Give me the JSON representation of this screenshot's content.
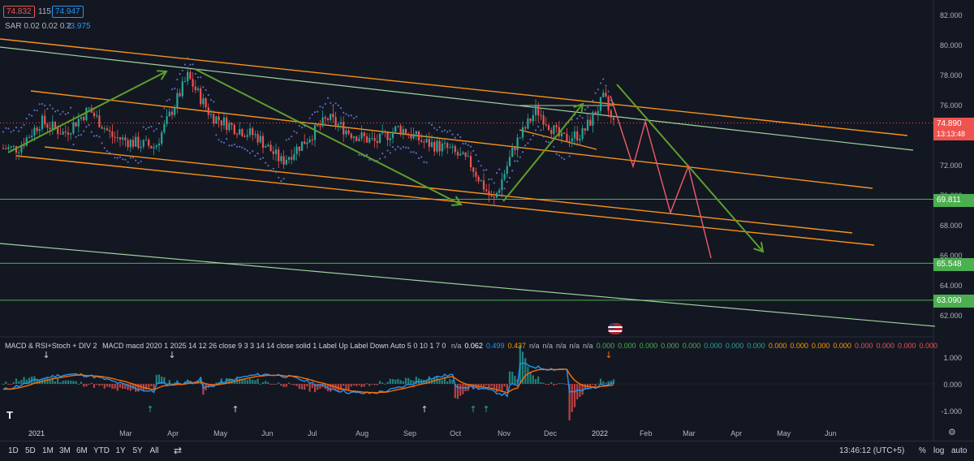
{
  "header": {
    "ohlc_badges": [
      "74.832",
      "115",
      "74.947"
    ],
    "sar_label": "SAR 0.02 0.02 0.2",
    "sar_value": "73.975"
  },
  "colors": {
    "background": "#131722",
    "orange": "#f7931a",
    "green_line": "#9fd49f",
    "green_arrow": "#5e9f2b",
    "red_arrow": "#f45b69",
    "horizontal": "#4caf50",
    "sar_dots": "#5c6bc0",
    "up": "#26a69a",
    "down": "#ef5350",
    "macd": "#2196f3",
    "signal": "#ff6d00"
  },
  "price_axis": {
    "ticks": [
      "82.000",
      "80.000",
      "78.000",
      "76.000",
      "74.000",
      "72.000",
      "70.000",
      "68.000",
      "66.000",
      "64.000",
      "62.000"
    ],
    "current_price": "74.890",
    "countdown": "13:13:48",
    "levels": [
      "69.811",
      "65.548",
      "63.090"
    ]
  },
  "time_axis": {
    "ticks": [
      "2021",
      "Mar",
      "Apr",
      "May",
      "Jun",
      "Jul",
      "Aug",
      "Sep",
      "Oct",
      "Nov",
      "Dec",
      "2022",
      "Feb",
      "Mar",
      "Apr",
      "May",
      "Jun"
    ]
  },
  "indicator": {
    "title": "MACD & RSI+Stoch + DIV 2",
    "params": "MACD macd 2020 1 2025 14 12 26 close 9 3 3 14 14 close solid 1 Label Up Label Down Auto 5 0 10 1 7 0",
    "values": [
      {
        "v": "n/a",
        "c": "#b2b5be"
      },
      {
        "v": "0.062",
        "c": "#ffffff"
      },
      {
        "v": "0.499",
        "c": "#2196f3"
      },
      {
        "v": "0.437",
        "c": "#ff9800"
      },
      {
        "v": "n/a",
        "c": "#b2b5be"
      },
      {
        "v": "n/a",
        "c": "#b2b5be"
      },
      {
        "v": "n/a",
        "c": "#b2b5be"
      },
      {
        "v": "n/a",
        "c": "#b2b5be"
      },
      {
        "v": "n/a",
        "c": "#b2b5be"
      },
      {
        "v": "0.000",
        "c": "#4caf50"
      },
      {
        "v": "0.000",
        "c": "#4caf50"
      },
      {
        "v": "0.000",
        "c": "#4caf50"
      },
      {
        "v": "0.000",
        "c": "#4caf50"
      },
      {
        "v": "0.000",
        "c": "#4caf50"
      },
      {
        "v": "0.000",
        "c": "#26a69a"
      },
      {
        "v": "0.000",
        "c": "#26a69a"
      },
      {
        "v": "0.000",
        "c": "#26a69a"
      },
      {
        "v": "0.000",
        "c": "#ff9800"
      },
      {
        "v": "0.000",
        "c": "#ff9800"
      },
      {
        "v": "0.000",
        "c": "#ff9800"
      },
      {
        "v": "0.000",
        "c": "#ff9800"
      },
      {
        "v": "0.000",
        "c": "#ef5350"
      },
      {
        "v": "0.000",
        "c": "#ef5350"
      },
      {
        "v": "0.000",
        "c": "#ef5350"
      },
      {
        "v": "0.000",
        "c": "#ef5350"
      }
    ],
    "axis": [
      "1.000",
      "0.000",
      "-1.000"
    ]
  },
  "toolbar": {
    "ranges": [
      "1D",
      "5D",
      "1M",
      "3M",
      "6M",
      "YTD",
      "1Y",
      "5Y",
      "All"
    ],
    "clock": "13:46:12 (UTC+5)",
    "percent": "%",
    "log": "log",
    "auto": "auto"
  },
  "chart_data": {
    "type": "candlestick",
    "ylim": [
      61.2,
      82.6
    ],
    "series_close": [
      {
        "x": "2020-12-21",
        "y": 73.2
      },
      {
        "x": "2021-01-05",
        "y": 75.0
      },
      {
        "x": "2021-01-20",
        "y": 74.2
      },
      {
        "x": "2021-02-05",
        "y": 75.8
      },
      {
        "x": "2021-02-20",
        "y": 74.0
      },
      {
        "x": "2021-03-05",
        "y": 73.6
      },
      {
        "x": "2021-03-20",
        "y": 73.3
      },
      {
        "x": "2021-04-01",
        "y": 76.0
      },
      {
        "x": "2021-04-10",
        "y": 78.0
      },
      {
        "x": "2021-04-25",
        "y": 75.4
      },
      {
        "x": "2021-05-10",
        "y": 74.6
      },
      {
        "x": "2021-05-25",
        "y": 74.0
      },
      {
        "x": "2021-06-10",
        "y": 72.3
      },
      {
        "x": "2021-06-25",
        "y": 73.7
      },
      {
        "x": "2021-07-10",
        "y": 75.2
      },
      {
        "x": "2021-07-25",
        "y": 74.2
      },
      {
        "x": "2021-08-10",
        "y": 73.6
      },
      {
        "x": "2021-08-25",
        "y": 74.6
      },
      {
        "x": "2021-09-10",
        "y": 73.6
      },
      {
        "x": "2021-09-25",
        "y": 73.2
      },
      {
        "x": "2021-10-10",
        "y": 72.2
      },
      {
        "x": "2021-10-25",
        "y": 69.6
      },
      {
        "x": "2021-11-08",
        "y": 73.4
      },
      {
        "x": "2021-11-22",
        "y": 75.8
      },
      {
        "x": "2021-12-08",
        "y": 73.8
      },
      {
        "x": "2021-12-22",
        "y": 74.2
      },
      {
        "x": "2022-01-05",
        "y": 76.6
      },
      {
        "x": "2022-01-10",
        "y": 74.89
      }
    ],
    "horizontal_levels": [
      69.811,
      65.548,
      63.09
    ],
    "macd_range": [
      -1.2,
      1.3
    ]
  }
}
